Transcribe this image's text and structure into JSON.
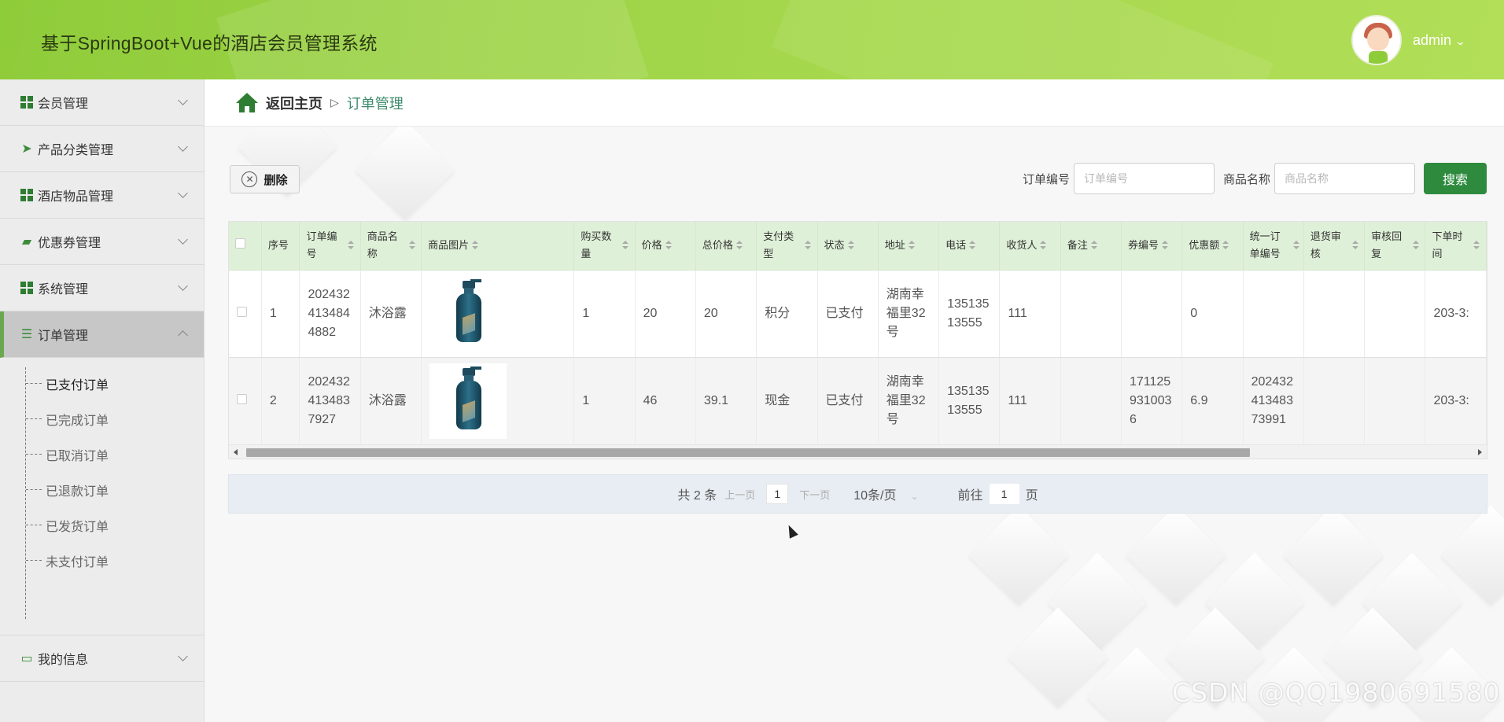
{
  "header": {
    "title": "基于SpringBoot+Vue的酒店会员管理系统",
    "user": "admin"
  },
  "sidebar": {
    "items": [
      {
        "label": "会员管理",
        "icon": "grid-icon"
      },
      {
        "label": "产品分类管理",
        "icon": "paper-plane-icon"
      },
      {
        "label": "酒店物品管理",
        "icon": "grid-icon"
      },
      {
        "label": "优惠券管理",
        "icon": "wallet-icon"
      },
      {
        "label": "系统管理",
        "icon": "grid-icon"
      },
      {
        "label": "订单管理",
        "icon": "list-icon",
        "expanded": true
      },
      {
        "label": "我的信息",
        "icon": "card-icon"
      }
    ],
    "submenu": [
      "已支付订单",
      "已完成订单",
      "已取消订单",
      "已退款订单",
      "已发货订单",
      "未支付订单"
    ]
  },
  "breadcrumb": {
    "home": "返回主页",
    "separator": "▷",
    "current": "订单管理"
  },
  "toolbar": {
    "delete_label": "删除"
  },
  "search": {
    "order_no_label": "订单编号",
    "order_no_placeholder": "订单编号",
    "product_name_label": "商品名称",
    "product_name_placeholder": "商品名称",
    "button": "搜索"
  },
  "table": {
    "columns": [
      "序号",
      "订单编号",
      "商品名称",
      "商品图片",
      "购买数量",
      "价格",
      "总价格",
      "支付类型",
      "状态",
      "地址",
      "电话",
      "收货人",
      "备注",
      "券编号",
      "优惠额",
      "统一订单编号",
      "退货审核",
      "审核回复",
      "下单时间"
    ],
    "rows": [
      {
        "index": "1",
        "order_no": "2024324134844882",
        "name": "沐浴露",
        "qty": "1",
        "price": "20",
        "total": "20",
        "pay_type": "积分",
        "status": "已支付",
        "address": "湖南幸福里32号",
        "phone": "13513513555",
        "receiver": "111",
        "remark": "",
        "coupon_no": "",
        "discount": "0",
        "unified_no": "",
        "return_audit": "",
        "audit_reply": "",
        "time": "203-3:"
      },
      {
        "index": "2",
        "order_no": "2024324134837927",
        "name": "沐浴露",
        "qty": "1",
        "price": "46",
        "total": "39.1",
        "pay_type": "现金",
        "status": "已支付",
        "address": "湖南幸福里32号",
        "phone": "13513513555",
        "receiver": "111",
        "remark": "",
        "coupon_no": "1711259310036",
        "discount": "6.9",
        "unified_no": "20243241348373991",
        "return_audit": "",
        "audit_reply": "",
        "time": "203-3:"
      }
    ]
  },
  "pager": {
    "total": "共 2 条",
    "prev": "上一页",
    "page": "1",
    "next": "下一页",
    "size": "10条/页",
    "goto": "前往",
    "goto_value": "1",
    "page_unit": "页"
  },
  "watermark": "CSDN @QQ1980691580"
}
